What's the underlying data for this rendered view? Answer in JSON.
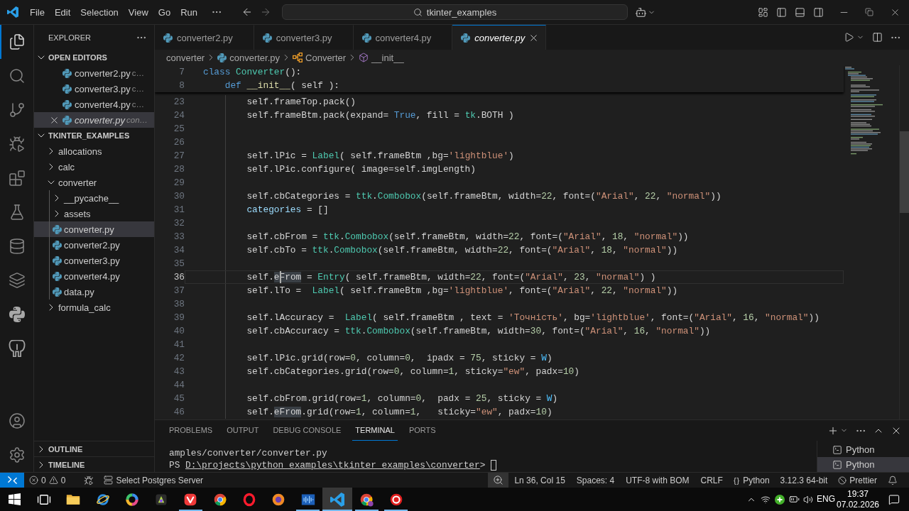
{
  "title_bar": {
    "menu": [
      "File",
      "Edit",
      "Selection",
      "View",
      "Go",
      "Run"
    ],
    "command_center": "tkinter_examples"
  },
  "activity_bar": {
    "top": [
      {
        "kind": "explorer",
        "selected": true
      },
      {
        "kind": "search",
        "selected": false
      },
      {
        "kind": "source-control",
        "selected": false
      },
      {
        "kind": "run-debug",
        "selected": false
      },
      {
        "kind": "extensions",
        "selected": false
      },
      {
        "kind": "testing",
        "selected": false
      },
      {
        "kind": "database",
        "selected": false
      },
      {
        "kind": "layers",
        "selected": false
      },
      {
        "kind": "python",
        "selected": false
      },
      {
        "kind": "postgres",
        "selected": false
      }
    ],
    "bottom": [
      {
        "kind": "account"
      },
      {
        "kind": "settings"
      }
    ]
  },
  "sidebar": {
    "title": "EXPLORER",
    "open_editors": {
      "title": "OPEN EDITORS",
      "expanded": true,
      "items": [
        {
          "name": "converter2.py",
          "description": "c…",
          "preview": false,
          "selected": false
        },
        {
          "name": "converter3.py",
          "description": "c…",
          "preview": false,
          "selected": false
        },
        {
          "name": "converter4.py",
          "description": "c…",
          "preview": false,
          "selected": false
        },
        {
          "name": "converter.py",
          "description": "con…",
          "preview": true,
          "selected": true
        }
      ]
    },
    "folder": {
      "title": "TKINTER_EXAMPLES",
      "expanded": true,
      "children": [
        {
          "name": "allocations",
          "kind": "folder",
          "expanded": false,
          "selected": false
        },
        {
          "name": "calc",
          "kind": "folder",
          "expanded": false,
          "selected": false
        },
        {
          "name": "converter",
          "kind": "folder",
          "expanded": true,
          "selected": false,
          "children": [
            {
              "name": "__pycache__",
              "kind": "folder",
              "expanded": false,
              "selected": false
            },
            {
              "name": "assets",
              "kind": "folder",
              "expanded": false,
              "selected": false
            },
            {
              "name": "converter.py",
              "kind": "file",
              "selected": true
            },
            {
              "name": "converter2.py",
              "kind": "file",
              "selected": false
            },
            {
              "name": "converter3.py",
              "kind": "file",
              "selected": false
            },
            {
              "name": "converter4.py",
              "kind": "file",
              "selected": false
            },
            {
              "name": "data.py",
              "kind": "file",
              "selected": false
            }
          ]
        },
        {
          "name": "formula_calc",
          "kind": "folder",
          "expanded": false,
          "selected": false
        }
      ]
    },
    "sections": [
      {
        "title": "OUTLINE",
        "expanded": false
      },
      {
        "title": "TIMELINE",
        "expanded": false
      }
    ]
  },
  "tabs": [
    {
      "label": "converter2.py",
      "preview": false,
      "selected": false
    },
    {
      "label": "converter3.py",
      "preview": false,
      "selected": false
    },
    {
      "label": "converter4.py",
      "preview": false,
      "selected": false
    },
    {
      "label": "converter.py",
      "preview": true,
      "selected": true
    }
  ],
  "breadcrumbs": [
    {
      "kind": "folder",
      "label": "converter"
    },
    {
      "kind": "file",
      "label": "converter.py"
    },
    {
      "kind": "class",
      "label": "Converter"
    },
    {
      "kind": "method",
      "label": "__init__"
    }
  ],
  "editor": {
    "sticky_lines": [
      {
        "number": "7",
        "current": false,
        "tokens": [
          {
            "kind": "keyword",
            "text": "class"
          },
          {
            "kind": "type",
            "text": " Converter"
          },
          {
            "kind": "plain",
            "text": "():"
          }
        ]
      },
      {
        "number": "8",
        "current": false,
        "tokens": [
          {
            "kind": "keyword",
            "text": "    def"
          },
          {
            "kind": "function",
            "text": " __init__"
          },
          {
            "kind": "plain",
            "text": "( self ):"
          }
        ]
      }
    ],
    "lines": [
      {
        "number": "23",
        "current": false,
        "tokens": [
          {
            "kind": "plain",
            "text": "        self.frameTop.pack()"
          }
        ]
      },
      {
        "number": "24",
        "current": false,
        "tokens": [
          {
            "kind": "plain",
            "text": "        self.frameBtm.pack(expand= "
          },
          {
            "kind": "keyword",
            "text": "True"
          },
          {
            "kind": "plain",
            "text": ", fill = "
          },
          {
            "kind": "type",
            "text": "tk"
          },
          {
            "kind": "plain",
            "text": ".BOTH )"
          }
        ]
      },
      {
        "number": "25",
        "current": false
      },
      {
        "number": "26",
        "current": false
      },
      {
        "number": "27",
        "current": false,
        "tokens": [
          {
            "kind": "plain",
            "text": "        self.lPic = "
          },
          {
            "kind": "type",
            "text": "Label"
          },
          {
            "kind": "plain",
            "text": "( self.frameBtm ,bg="
          },
          {
            "kind": "string",
            "text": "'lightblue'"
          },
          {
            "kind": "plain",
            "text": ")"
          }
        ]
      },
      {
        "number": "28",
        "current": false,
        "tokens": [
          {
            "kind": "plain",
            "text": "        self.lPic.configure( image=self.imgLength)"
          }
        ]
      },
      {
        "number": "29",
        "current": false
      },
      {
        "number": "30",
        "current": false,
        "tokens": [
          {
            "kind": "plain",
            "text": "        self.cbCategories = "
          },
          {
            "kind": "type",
            "text": "ttk"
          },
          {
            "kind": "plain",
            "text": "."
          },
          {
            "kind": "type",
            "text": "Combobox"
          },
          {
            "kind": "plain",
            "text": "(self.frameBtm, width="
          },
          {
            "kind": "number",
            "text": "22"
          },
          {
            "kind": "plain",
            "text": ", font=("
          },
          {
            "kind": "string",
            "text": "\"Arial\""
          },
          {
            "kind": "plain",
            "text": ", "
          },
          {
            "kind": "number",
            "text": "22"
          },
          {
            "kind": "plain",
            "text": ", "
          },
          {
            "kind": "string",
            "text": "\"normal\""
          },
          {
            "kind": "plain",
            "text": "))"
          }
        ]
      },
      {
        "number": "31",
        "current": false,
        "tokens": [
          {
            "kind": "variable",
            "text": "        categories"
          },
          {
            "kind": "plain",
            "text": " = []"
          }
        ]
      },
      {
        "number": "32",
        "current": false
      },
      {
        "number": "33",
        "current": false,
        "tokens": [
          {
            "kind": "plain",
            "text": "        self.cbFrom = "
          },
          {
            "kind": "type",
            "text": "ttk"
          },
          {
            "kind": "plain",
            "text": "."
          },
          {
            "kind": "type",
            "text": "Combobox"
          },
          {
            "kind": "plain",
            "text": "(self.frameBtm, width="
          },
          {
            "kind": "number",
            "text": "22"
          },
          {
            "kind": "plain",
            "text": ", font=("
          },
          {
            "kind": "string",
            "text": "\"Arial\""
          },
          {
            "kind": "plain",
            "text": ", "
          },
          {
            "kind": "number",
            "text": "18"
          },
          {
            "kind": "plain",
            "text": ", "
          },
          {
            "kind": "string",
            "text": "\"normal\""
          },
          {
            "kind": "plain",
            "text": "))"
          }
        ]
      },
      {
        "number": "34",
        "current": false,
        "tokens": [
          {
            "kind": "plain",
            "text": "        self.cbTo = "
          },
          {
            "kind": "type",
            "text": "ttk"
          },
          {
            "kind": "plain",
            "text": "."
          },
          {
            "kind": "type",
            "text": "Combobox"
          },
          {
            "kind": "plain",
            "text": "(self.frameBtm, width="
          },
          {
            "kind": "number",
            "text": "22"
          },
          {
            "kind": "plain",
            "text": ", font=("
          },
          {
            "kind": "string",
            "text": "\"Arial\""
          },
          {
            "kind": "plain",
            "text": ", "
          },
          {
            "kind": "number",
            "text": "18"
          },
          {
            "kind": "plain",
            "text": ", "
          },
          {
            "kind": "string",
            "text": "\"normal\""
          },
          {
            "kind": "plain",
            "text": "))"
          }
        ]
      },
      {
        "number": "35",
        "current": false
      },
      {
        "number": "36",
        "current": true,
        "tokens": [
          {
            "kind": "plain",
            "text": "        self."
          },
          {
            "kind": "match",
            "text": "e"
          },
          {
            "kind": "caret"
          },
          {
            "kind": "match",
            "text": "From"
          },
          {
            "kind": "plain",
            "text": " = "
          },
          {
            "kind": "type",
            "text": "Entry"
          },
          {
            "kind": "plain",
            "text": "( self.frameBtm, width="
          },
          {
            "kind": "number",
            "text": "22"
          },
          {
            "kind": "plain",
            "text": ", font=("
          },
          {
            "kind": "string",
            "text": "\"Arial\""
          },
          {
            "kind": "plain",
            "text": ", "
          },
          {
            "kind": "number",
            "text": "23"
          },
          {
            "kind": "plain",
            "text": ", "
          },
          {
            "kind": "string",
            "text": "\"normal\""
          },
          {
            "kind": "plain",
            "text": ") )"
          }
        ]
      },
      {
        "number": "37",
        "current": false,
        "tokens": [
          {
            "kind": "plain",
            "text": "        self.lTo =  "
          },
          {
            "kind": "type",
            "text": "Label"
          },
          {
            "kind": "plain",
            "text": "( self.frameBtm ,bg="
          },
          {
            "kind": "string",
            "text": "'lightblue'"
          },
          {
            "kind": "plain",
            "text": ", font=("
          },
          {
            "kind": "string",
            "text": "\"Arial\""
          },
          {
            "kind": "plain",
            "text": ", "
          },
          {
            "kind": "number",
            "text": "22"
          },
          {
            "kind": "plain",
            "text": ", "
          },
          {
            "kind": "string",
            "text": "\"normal\""
          },
          {
            "kind": "plain",
            "text": "))"
          }
        ]
      },
      {
        "number": "38",
        "current": false
      },
      {
        "number": "39",
        "current": false,
        "tokens": [
          {
            "kind": "plain",
            "text": "        self.lAccuracy =  "
          },
          {
            "kind": "type",
            "text": "Label"
          },
          {
            "kind": "plain",
            "text": "( self.frameBtm , text = "
          },
          {
            "kind": "string",
            "text": "'Точність'"
          },
          {
            "kind": "plain",
            "text": ", bg="
          },
          {
            "kind": "string",
            "text": "'lightblue'"
          },
          {
            "kind": "plain",
            "text": ", font=("
          },
          {
            "kind": "string",
            "text": "\"Arial\""
          },
          {
            "kind": "plain",
            "text": ", "
          },
          {
            "kind": "number",
            "text": "16"
          },
          {
            "kind": "plain",
            "text": ", "
          },
          {
            "kind": "string",
            "text": "\"normal\""
          },
          {
            "kind": "plain",
            "text": "))"
          }
        ]
      },
      {
        "number": "40",
        "current": false,
        "tokens": [
          {
            "kind": "plain",
            "text": "        self.cbAccuracy = "
          },
          {
            "kind": "type",
            "text": "ttk"
          },
          {
            "kind": "plain",
            "text": "."
          },
          {
            "kind": "type",
            "text": "Combobox"
          },
          {
            "kind": "plain",
            "text": "(self.frameBtm, width="
          },
          {
            "kind": "number",
            "text": "30"
          },
          {
            "kind": "plain",
            "text": ", font=("
          },
          {
            "kind": "string",
            "text": "\"Arial\""
          },
          {
            "kind": "plain",
            "text": ", "
          },
          {
            "kind": "number",
            "text": "16"
          },
          {
            "kind": "plain",
            "text": ", "
          },
          {
            "kind": "string",
            "text": "\"normal\""
          },
          {
            "kind": "plain",
            "text": "))"
          }
        ]
      },
      {
        "number": "41",
        "current": false
      },
      {
        "number": "42",
        "current": false,
        "tokens": [
          {
            "kind": "plain",
            "text": "        self.lPic.grid(row="
          },
          {
            "kind": "number",
            "text": "0"
          },
          {
            "kind": "plain",
            "text": ", column="
          },
          {
            "kind": "number",
            "text": "0"
          },
          {
            "kind": "plain",
            "text": ",  ipadx = "
          },
          {
            "kind": "number",
            "text": "75"
          },
          {
            "kind": "plain",
            "text": ", sticky = "
          },
          {
            "kind": "constant",
            "text": "W"
          },
          {
            "kind": "plain",
            "text": ")"
          }
        ]
      },
      {
        "number": "43",
        "current": false,
        "tokens": [
          {
            "kind": "plain",
            "text": "        self.cbCategories.grid(row="
          },
          {
            "kind": "number",
            "text": "0"
          },
          {
            "kind": "plain",
            "text": ", column="
          },
          {
            "kind": "number",
            "text": "1"
          },
          {
            "kind": "plain",
            "text": ", sticky="
          },
          {
            "kind": "string",
            "text": "\"ew\""
          },
          {
            "kind": "plain",
            "text": ", padx="
          },
          {
            "kind": "number",
            "text": "10"
          },
          {
            "kind": "plain",
            "text": ")"
          }
        ]
      },
      {
        "number": "44",
        "current": false
      },
      {
        "number": "45",
        "current": false,
        "tokens": [
          {
            "kind": "plain",
            "text": "        self.cbFrom.grid(row="
          },
          {
            "kind": "number",
            "text": "1"
          },
          {
            "kind": "plain",
            "text": ", column="
          },
          {
            "kind": "number",
            "text": "0"
          },
          {
            "kind": "plain",
            "text": ",  padx = "
          },
          {
            "kind": "number",
            "text": "25"
          },
          {
            "kind": "plain",
            "text": ", sticky = "
          },
          {
            "kind": "constant",
            "text": "W"
          },
          {
            "kind": "plain",
            "text": ")"
          }
        ]
      },
      {
        "number": "46",
        "current": false,
        "tokens": [
          {
            "kind": "plain",
            "text": "        self."
          },
          {
            "kind": "match",
            "text": "eFrom"
          },
          {
            "kind": "plain",
            "text": ".grid(row="
          },
          {
            "kind": "number",
            "text": "1"
          },
          {
            "kind": "plain",
            "text": ", column="
          },
          {
            "kind": "number",
            "text": "1"
          },
          {
            "kind": "plain",
            "text": ",   sticky="
          },
          {
            "kind": "string",
            "text": "\"ew\""
          },
          {
            "kind": "plain",
            "text": ", padx="
          },
          {
            "kind": "number",
            "text": "10"
          },
          {
            "kind": "plain",
            "text": ")"
          }
        ]
      }
    ]
  },
  "panel": {
    "tabs": [
      {
        "label": "PROBLEMS",
        "selected": false
      },
      {
        "label": "OUTPUT",
        "selected": false
      },
      {
        "label": "DEBUG CONSOLE",
        "selected": false
      },
      {
        "label": "TERMINAL",
        "selected": true
      },
      {
        "label": "PORTS",
        "selected": false
      }
    ],
    "terminal": [
      {
        "kind": "output",
        "text": "amples/converter/converter.py"
      },
      {
        "kind": "prompt",
        "prefix": "PS",
        "path": "D:\\projects\\python_examples\\tkinter_examples\\converter",
        "suffix": ">"
      }
    ],
    "terminals": [
      {
        "label": "Python",
        "selected": false
      },
      {
        "label": "Python",
        "selected": true
      }
    ]
  },
  "status_bar": {
    "errors": "0",
    "warnings": "0",
    "left": [
      {
        "kind": "run"
      },
      {
        "kind": "server",
        "label": "Select Postgres Server"
      }
    ],
    "right": [
      {
        "kind": "zoom"
      },
      {
        "kind": "text",
        "label": "Ln 36, Col 15"
      },
      {
        "kind": "text",
        "label": "Spaces: 4"
      },
      {
        "kind": "text",
        "label": "UTF-8 with BOM"
      },
      {
        "kind": "text",
        "label": "CRLF"
      },
      {
        "kind": "language",
        "symbol": "{}",
        "label": "Python"
      },
      {
        "kind": "text",
        "label": "3.12.3 64-bit"
      },
      {
        "kind": "prettier",
        "label": "Prettier"
      },
      {
        "kind": "bell"
      }
    ]
  },
  "taskbar": {
    "apps": [
      {
        "kind": "folder",
        "selected": false,
        "running": false
      },
      {
        "kind": "globe",
        "selected": false,
        "running": false
      },
      {
        "kind": "color-wheel",
        "selected": false,
        "running": false
      },
      {
        "kind": "app-tile",
        "selected": false,
        "running": false
      },
      {
        "kind": "rounded-tile",
        "selected": false,
        "running": true
      },
      {
        "kind": "tri-color",
        "selected": false,
        "running": false
      },
      {
        "kind": "ring",
        "selected": false,
        "running": false
      },
      {
        "kind": "orange-circle",
        "selected": false,
        "running": false
      },
      {
        "kind": "wave-window",
        "selected": false,
        "running": true
      },
      {
        "kind": "code-editor",
        "selected": true,
        "running": true
      },
      {
        "kind": "tri-color-badge",
        "selected": false,
        "running": true
      },
      {
        "kind": "record",
        "selected": false,
        "running": true
      }
    ],
    "tray": {
      "language": "ENG",
      "time": "19:37",
      "date": "07.02.2026"
    }
  }
}
